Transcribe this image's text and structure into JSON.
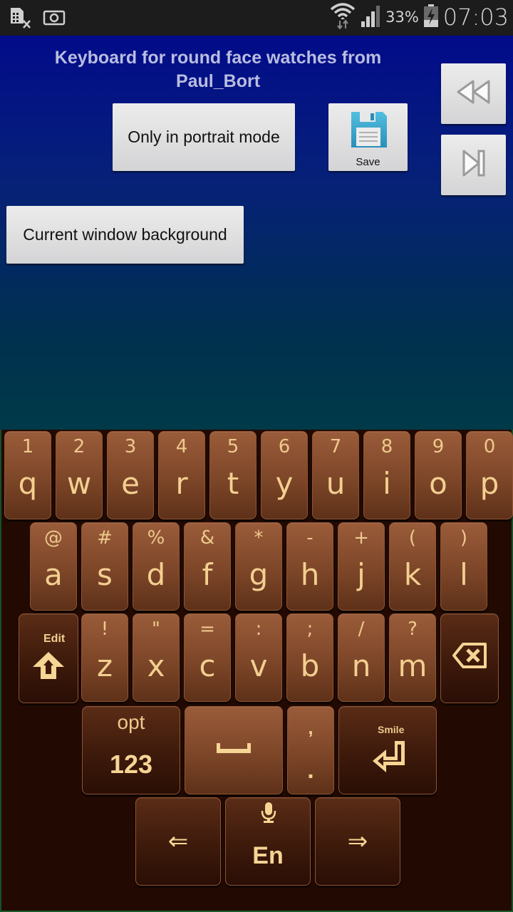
{
  "status_bar": {
    "left_icons": [
      "sim-card-missing-icon",
      "screenshot-icon"
    ],
    "right_icons": [
      "wifi-icon",
      "signal-icon",
      "battery-charging-icon"
    ],
    "battery_percent": "33%",
    "clock": "07:03"
  },
  "app": {
    "title": "Keyboard for round face watches from Paul_Bort",
    "buttons": {
      "portrait": "Only in portrait mode",
      "save": "Save",
      "background": "Current window background",
      "rewind_icon": "rewind-icon",
      "skip_icon": "skip-next-icon"
    },
    "colors": {
      "background_top": "#020b8a",
      "background_bottom": "#003a48",
      "title_text": "#b9bde0"
    }
  },
  "keyboard": {
    "colors": {
      "key_light": "#8a5030",
      "key_dark": "#3d1a0b",
      "glyph": "#f3cf90",
      "background": "#220a03"
    },
    "row1": [
      {
        "sub": "1",
        "main": "q"
      },
      {
        "sub": "2",
        "main": "w"
      },
      {
        "sub": "3",
        "main": "e"
      },
      {
        "sub": "4",
        "main": "r"
      },
      {
        "sub": "5",
        "main": "t"
      },
      {
        "sub": "6",
        "main": "y"
      },
      {
        "sub": "7",
        "main": "u"
      },
      {
        "sub": "8",
        "main": "i"
      },
      {
        "sub": "9",
        "main": "o"
      },
      {
        "sub": "0",
        "main": "p"
      }
    ],
    "row2": [
      {
        "sub": "@",
        "main": "a"
      },
      {
        "sub": "#",
        "main": "s"
      },
      {
        "sub": "%",
        "main": "d"
      },
      {
        "sub": "&",
        "main": "f"
      },
      {
        "sub": "*",
        "main": "g"
      },
      {
        "sub": "-",
        "main": "h"
      },
      {
        "sub": "+",
        "main": "j"
      },
      {
        "sub": "(",
        "main": "k"
      },
      {
        "sub": ")",
        "main": "l"
      }
    ],
    "row3": [
      {
        "sub": "!",
        "main": "z"
      },
      {
        "sub": "\"",
        "main": "x"
      },
      {
        "sub": "=",
        "main": "c"
      },
      {
        "sub": ":",
        "main": "v"
      },
      {
        "sub": ";",
        "main": "b"
      },
      {
        "sub": "/",
        "main": "n"
      },
      {
        "sub": "?",
        "main": "m"
      }
    ],
    "shift": {
      "label": "Edit",
      "icon": "shift-arrow-icon"
    },
    "backspace": {
      "icon": "backspace-icon"
    },
    "opt": {
      "top": "opt",
      "main": "123"
    },
    "space": {
      "icon": "space-bar-icon"
    },
    "punct": {
      "top": ",",
      "main": "."
    },
    "enter": {
      "label": "Smile",
      "icon": "enter-icon"
    },
    "left_arrow": "⇐",
    "right_arrow": "⇒",
    "lang": {
      "main": "En",
      "icon": "microphone-icon"
    }
  }
}
